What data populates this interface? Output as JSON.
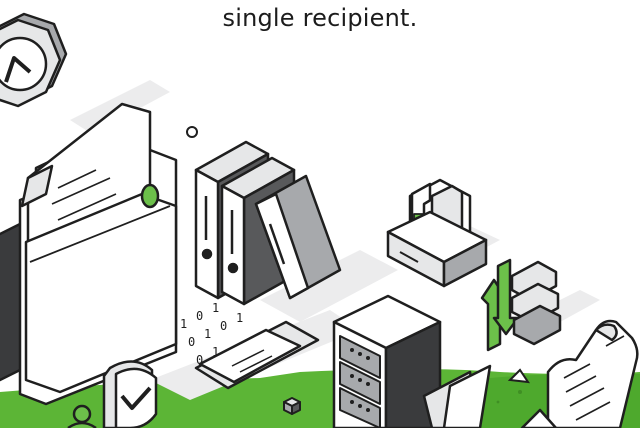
{
  "caption": "single recipient.",
  "colors": {
    "accent_green": "#6cc04a",
    "ground_green": "#5cb536",
    "ground_dark": "#3f8f24",
    "outline": "#1f1f1f",
    "light_gray": "#e6e7e8",
    "mid_gray": "#a7a9ac",
    "dark_gray": "#58595b",
    "shadow": "#d9dadb"
  },
  "binary_labels": [
    "1",
    "0",
    "1",
    "0",
    "1",
    "0",
    "1",
    "0",
    "1"
  ],
  "icons": [
    "clock-badge-icon",
    "document-stack-icon",
    "binders-icon",
    "file-tray-icon",
    "sync-arrows-icon",
    "books-stack-icon",
    "shield-check-icon",
    "server-rack-icon",
    "paper-scroll-icon",
    "folder-icon",
    "user-avatar-icon"
  ]
}
